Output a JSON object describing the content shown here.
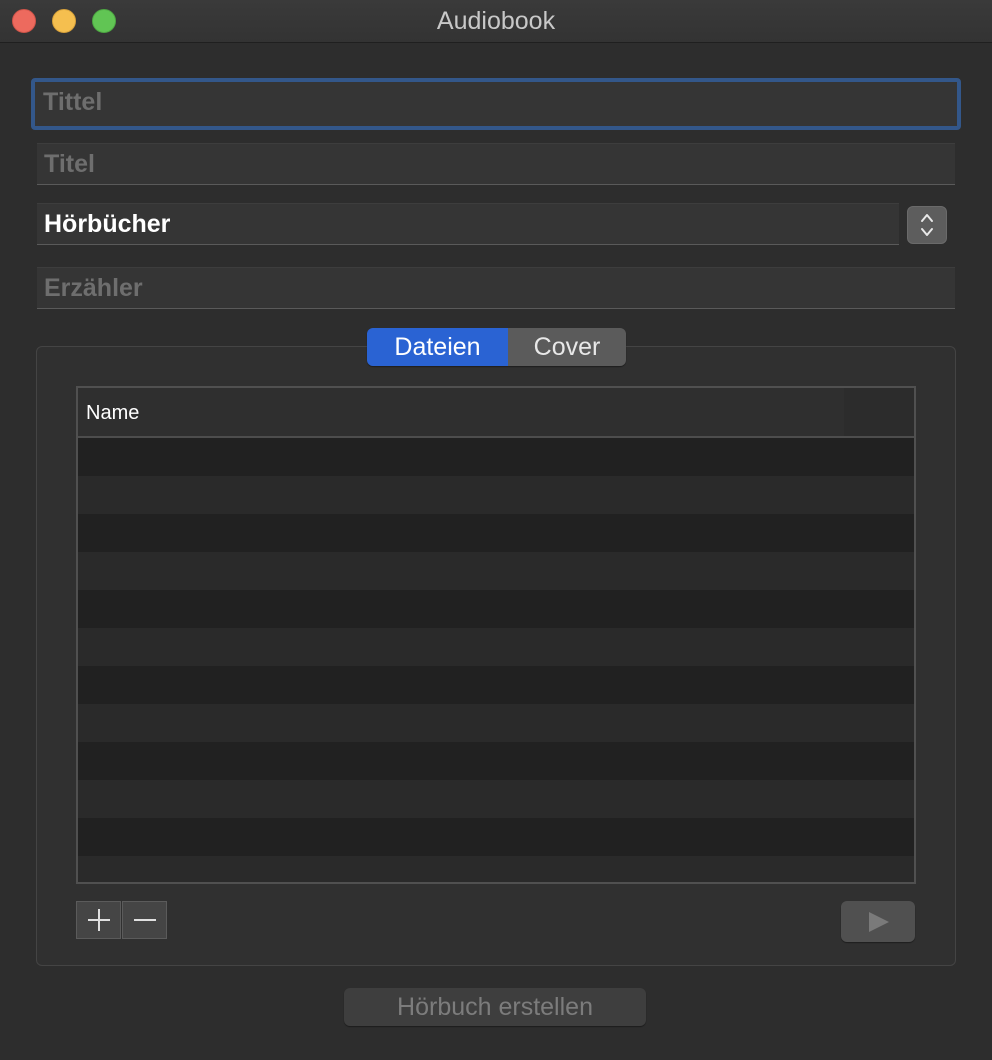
{
  "window": {
    "title": "Audiobook"
  },
  "form": {
    "title_placeholder": "Tittel",
    "subtitle_placeholder": "Titel",
    "genre_value": "Hörbücher",
    "narrator_placeholder": "Erzähler"
  },
  "tabs": [
    {
      "label": "Dateien",
      "active": true
    },
    {
      "label": "Cover",
      "active": false
    }
  ],
  "file_table": {
    "columns": [
      "Name"
    ],
    "rows": []
  },
  "list_controls": {
    "add_label": "+",
    "remove_label": "−",
    "play_icon": "play-icon"
  },
  "create_button": {
    "label": "Hörbuch erstellen",
    "enabled": false
  },
  "colors": {
    "accent": "#2a63d3",
    "focus_ring": "#33578a",
    "close": "#ed6a5e",
    "minimize": "#f5bf4f",
    "maximize": "#61c554"
  }
}
